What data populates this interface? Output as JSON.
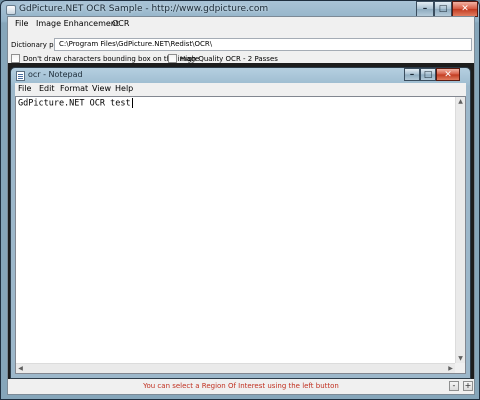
{
  "window": {
    "title": "GdPicture.NET OCR Sample  -  http://www.gdpicture.com",
    "minimize_glyph": "–",
    "maximize_glyph": "□",
    "close_glyph": "✕"
  },
  "menu": {
    "items": [
      "File",
      "Image Enhancement",
      "OCR"
    ]
  },
  "dictionary": {
    "label": "Dictionary path:",
    "value": "C:\\Program Files\\GdPicture.NET\\Redist\\OCR\\"
  },
  "options": {
    "no_bbox_label": "Don't draw characters bounding box on the image",
    "high_quality_label": "High Quality OCR - 2 Passes"
  },
  "notepad": {
    "title": "ocr - Notepad",
    "menu": [
      "File",
      "Edit",
      "Format",
      "View",
      "Help"
    ],
    "content": "GdPicture.NET OCR test",
    "minimize_glyph": "–",
    "maximize_glyph": "□",
    "close_glyph": "✕"
  },
  "status": {
    "message": "You can select a Region Of Interest using the left button",
    "zoom_out_glyph": "-",
    "zoom_in_glyph": "+"
  },
  "colors": {
    "status_text": "#c03020",
    "close_button": "#c13a20",
    "dark_area": "#1d1d1d"
  }
}
